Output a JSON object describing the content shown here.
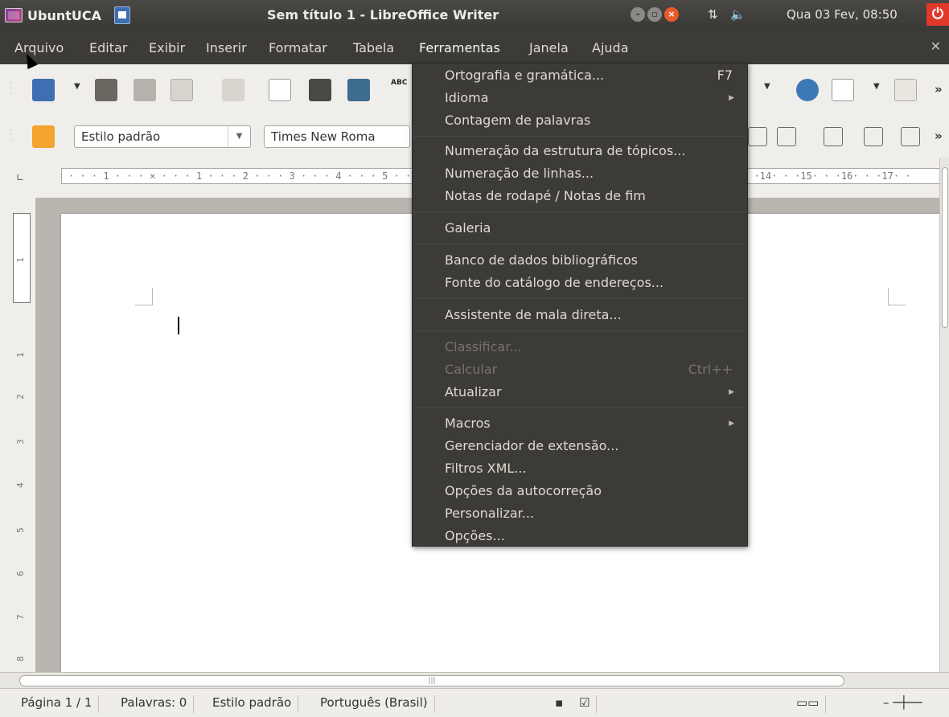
{
  "top_panel": {
    "app_name": "UbuntUCA",
    "window_title": "Sem título 1 - LibreOffice Writer",
    "clock": "Qua 03 Fev, 08:50"
  },
  "menubar": {
    "items": [
      {
        "label": "Arquivo"
      },
      {
        "label": "Editar"
      },
      {
        "label": "Exibir"
      },
      {
        "label": "Inserir"
      },
      {
        "label": "Formatar"
      },
      {
        "label": "Tabela"
      },
      {
        "label": "Ferramentas"
      },
      {
        "label": "Janela"
      },
      {
        "label": "Ajuda"
      }
    ]
  },
  "toolbar2": {
    "paragraph_style": "Estilo padrão",
    "font_name": "Times New Roma"
  },
  "ruler": {
    "text": "· · · 1 · · · ⨯ · · · 1 · · · 2 · · · 3 · · · 4 · · · 5 · · ·"
  },
  "ruler_right": {
    "text": "· ·14· · ·15· · ·16· · ·17· ·"
  },
  "tools_menu": {
    "items": [
      {
        "label": "Ortografia e gramática...",
        "shortcut": "F7"
      },
      {
        "label": "Idioma",
        "submenu": true
      },
      {
        "label": "Contagem de palavras"
      },
      {
        "label": "Numeração da estrutura de tópicos..."
      },
      {
        "label": "Numeração de linhas..."
      },
      {
        "label": "Notas de rodapé / Notas de fim"
      },
      {
        "label": "Galeria"
      },
      {
        "label": "Banco de dados bibliográficos"
      },
      {
        "label": "Fonte do catálogo de endereços..."
      },
      {
        "label": "Assistente de mala direta..."
      },
      {
        "label": "Classificar...",
        "disabled": true
      },
      {
        "label": "Calcular",
        "shortcut": "Ctrl++",
        "disabled": true
      },
      {
        "label": "Atualizar",
        "submenu": true
      },
      {
        "label": "Macros",
        "submenu": true
      },
      {
        "label": "Gerenciador de extensão..."
      },
      {
        "label": "Filtros XML..."
      },
      {
        "label": "Opções da autocorreção"
      },
      {
        "label": "Personalizar..."
      },
      {
        "label": "Opções..."
      }
    ]
  },
  "statusbar": {
    "page": "Página 1 / 1",
    "words": "Palavras: 0",
    "style": "Estilo padrão",
    "language": "Português (Brasil)"
  },
  "colors": {
    "panel": "#3c3b37",
    "menu_text": "#dfdbd2",
    "accent_close": "#e85a2b"
  }
}
